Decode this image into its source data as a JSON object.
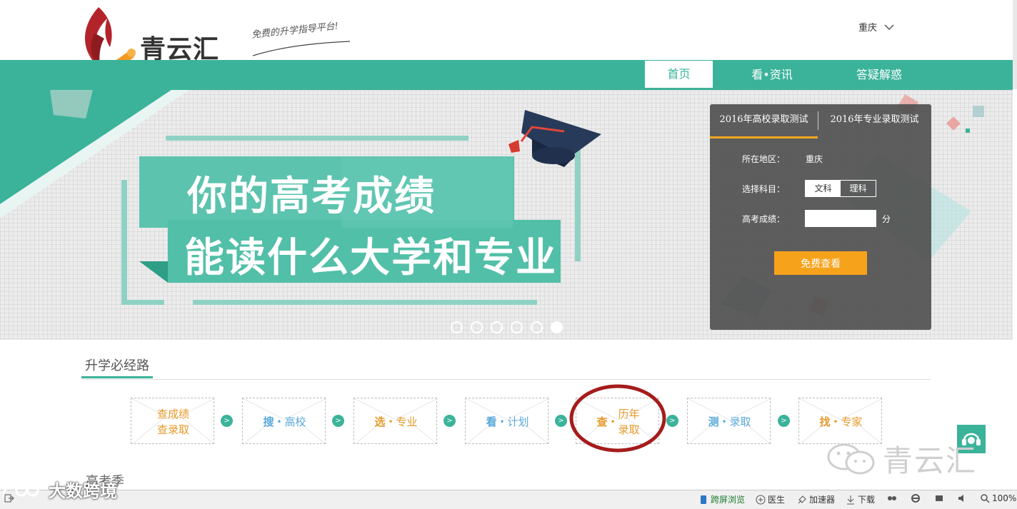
{
  "header": {
    "brand": "青云汇",
    "slogan": "免费的升学指导平台!",
    "city": "重庆"
  },
  "nav": {
    "items": [
      "首页",
      "看•资讯",
      "答疑解惑"
    ],
    "active": "首页"
  },
  "banner": {
    "headline_line1": "你的高考成绩",
    "headline_line2": "能读什么大学和专业",
    "slide_count": 6,
    "active_slide": 6
  },
  "form": {
    "tabs": [
      "2016年高校录取测试",
      "2016年专业录取测试"
    ],
    "active_tab": "2016年高校录取测试",
    "region_label": "所在地区：",
    "region_value": "重庆",
    "subject_label": "选择科目：",
    "subject_options": [
      "文科",
      "理科"
    ],
    "subject_selected": "文科",
    "score_label": "高考成绩：",
    "score_value": "",
    "score_unit": "分",
    "submit_label": "免费查看"
  },
  "path": {
    "title": "升学必经路",
    "steps": [
      {
        "line1": "查成绩",
        "line2": "查录取"
      },
      {
        "left": "搜",
        "right": "高校"
      },
      {
        "left": "选",
        "right": "专业"
      },
      {
        "left": "看",
        "right": "计划"
      },
      {
        "left": "查",
        "right_line1": "历年",
        "right_line2": "录取"
      },
      {
        "left": "测",
        "right": "录取"
      },
      {
        "left": "找",
        "right": "专家"
      }
    ],
    "arrow_glyph": ">",
    "highlighted_step": 5
  },
  "next_section": {
    "title": "高考季"
  },
  "watermarks": {
    "right": "青云汇",
    "left": "大数跨境"
  },
  "statusbar": {
    "items": [
      "跨屏浏览",
      "医生",
      "加速器",
      "下载"
    ],
    "zoom": "100%"
  },
  "colors": {
    "teal": "#3bb39a",
    "orange": "#f7a21b",
    "highlight_ring": "#a51c1c",
    "logo_red": "#b3242a"
  }
}
